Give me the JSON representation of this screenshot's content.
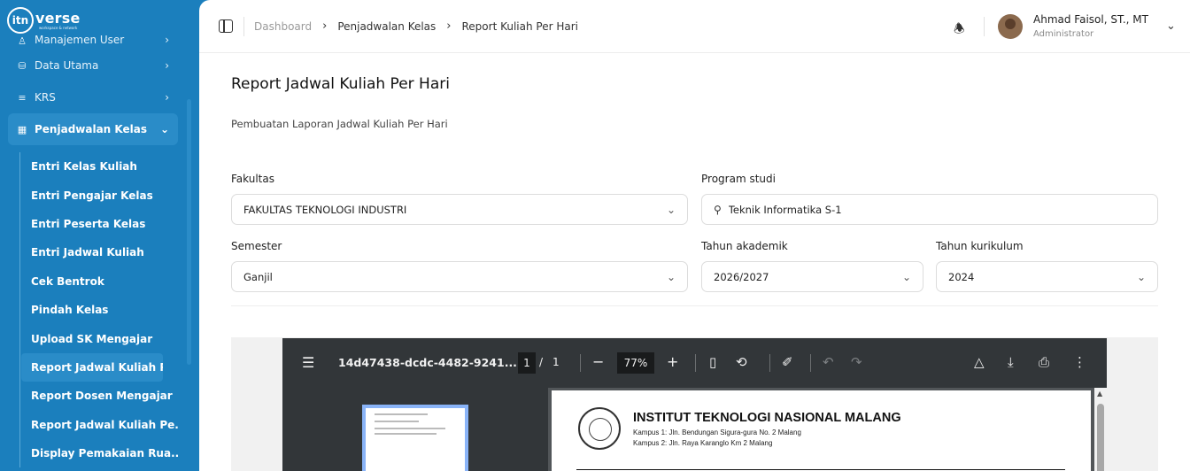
{
  "brand": {
    "mark": "itn",
    "word": "verse",
    "tagline": "workspace & network"
  },
  "sidebar": {
    "items": [
      {
        "label": "Manajemen User",
        "icon": "users-icon"
      },
      {
        "label": "Data Utama",
        "icon": "database-icon"
      },
      {
        "label": "KRS",
        "icon": "list-icon"
      },
      {
        "label": "Penjadwalan Kelas",
        "icon": "calendar-icon"
      }
    ],
    "submenu": [
      "Entri Kelas Kuliah",
      "Entri Pengajar Kelas",
      "Entri Peserta Kelas",
      "Entri Jadwal Kuliah",
      "Cek Bentrok",
      "Pindah Kelas",
      "Upload SK Mengajar",
      "Report Jadwal Kuliah Pe...",
      "Report Dosen Mengajar",
      "Report Jadwal Kuliah Pe...",
      "Display Pemakaian Rua..."
    ]
  },
  "breadcrumb": [
    "Dashboard",
    "Penjadwalan Kelas",
    "Report Kuliah Per Hari"
  ],
  "user": {
    "name": "Ahmad Faisol, ST., MT",
    "role": "Administrator"
  },
  "page": {
    "title": "Report Jadwal Kuliah Per Hari",
    "subtitle": "Pembuatan Laporan Jadwal Kuliah Per Hari"
  },
  "form": {
    "fakultas": {
      "label": "Fakultas",
      "value": "FAKULTAS TEKNOLOGI INDUSTRI"
    },
    "prodi": {
      "label": "Program studi",
      "value": "Teknik Informatika S-1"
    },
    "semester": {
      "label": "Semester",
      "value": "Ganjil"
    },
    "tahun_akademik": {
      "label": "Tahun akademik",
      "value": "2026/2027"
    },
    "tahun_kurikulum": {
      "label": "Tahun kurikulum",
      "value": "2024"
    }
  },
  "pdf": {
    "filename": "14d47438-dcdc-4482-9241...",
    "page": "1",
    "slash": "/",
    "total": "1",
    "zoom": "77%",
    "institution": "INSTITUT TEKNOLOGI NASIONAL MALANG",
    "campus1": "Kampus 1: Jln. Bendungan Sigura-gura No. 2 Malang",
    "campus2": "Kampus 2: Jln. Raya Karanglo Km 2 Malang"
  },
  "colors": {
    "sidebar": "#1b7fbd",
    "active": "#2a8cc8",
    "pdf_toolbar": "#323639"
  }
}
